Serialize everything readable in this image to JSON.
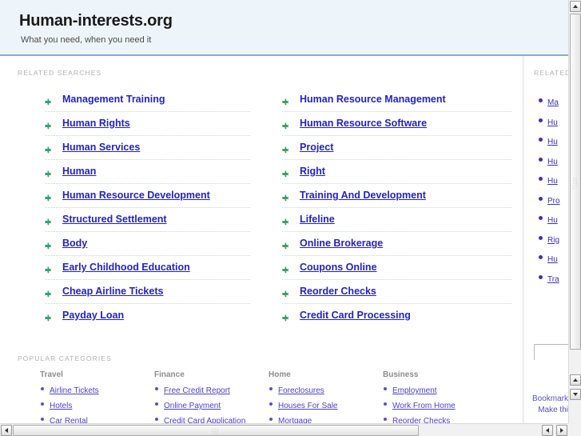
{
  "header": {
    "title": "Human-interests.org",
    "tagline": "What you need, when you need it"
  },
  "main": {
    "related_searches_label": "RELATED SEARCHES",
    "popular_categories_label": "POPULAR CATEGORIES",
    "related_searches": {
      "left_column": [
        "Management Training",
        "Human Rights",
        "Human Services",
        "Human",
        "Human Resource Development",
        "Structured Settlement",
        "Body",
        "Early Childhood Education",
        "Cheap Airline Tickets",
        "Payday Loan"
      ],
      "right_column": [
        "Human Resource Management",
        "Human Resource Software",
        "Project",
        "Right",
        "Training And Development",
        "Lifeline",
        "Online Brokerage",
        "Coupons Online",
        "Reorder Checks",
        "Credit Card Processing"
      ]
    },
    "popular_categories": [
      {
        "heading": "Travel",
        "links": [
          "Airline Tickets",
          "Hotels",
          "Car Rental"
        ]
      },
      {
        "heading": "Finance",
        "links": [
          "Free Credit Report",
          "Online Payment",
          "Credit Card Application"
        ]
      },
      {
        "heading": "Home",
        "links": [
          "Foreclosures",
          "Houses For Sale",
          "Mortgage"
        ]
      },
      {
        "heading": "Business",
        "links": [
          "Employment",
          "Work From Home",
          "Reorder Checks"
        ]
      }
    ]
  },
  "sidebar": {
    "label": "RELATED",
    "items": [
      "Ma",
      "Hu",
      "Hu",
      "Hu",
      "Hu",
      "Pro",
      "Hu",
      "Rig",
      "Hu",
      "Tra"
    ],
    "search_value": "",
    "search_placeholder": "",
    "footer_links": [
      "Bookmark",
      "Make thi"
    ]
  },
  "colors": {
    "header_bg": "#eef5fa",
    "header_border": "#8aa9d6",
    "link": "#2222cc",
    "bullet_green": "#3a9e6e",
    "label_gray": "#b2b2b2"
  },
  "icons": {
    "bullet": "green-arrow-bullet-icon",
    "dot": "dot-bullet-icon",
    "scroll_up": "scroll-up-arrow-icon",
    "scroll_down": "scroll-down-arrow-icon",
    "scroll_left": "scroll-left-arrow-icon",
    "scroll_right": "scroll-right-arrow-icon"
  }
}
